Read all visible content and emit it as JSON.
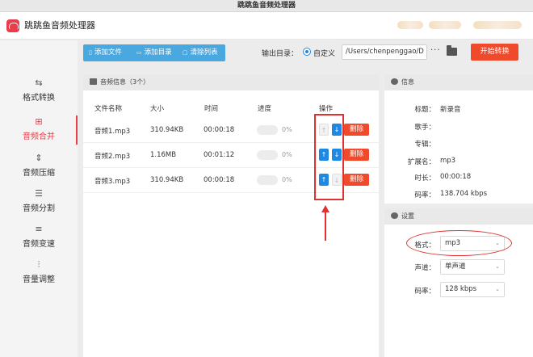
{
  "window": {
    "title": "跳跳鱼音频处理器"
  },
  "app": {
    "name": "跳跳鱼音频处理器"
  },
  "sidebar": {
    "items": [
      {
        "label": "格式转换",
        "icon": "format-convert-icon"
      },
      {
        "label": "音频合并",
        "icon": "merge-icon",
        "active": true
      },
      {
        "label": "音频压缩",
        "icon": "compress-icon"
      },
      {
        "label": "音频分割",
        "icon": "split-icon"
      },
      {
        "label": "音频变速",
        "icon": "speed-icon"
      },
      {
        "label": "音量调整",
        "icon": "volume-icon"
      }
    ]
  },
  "toolbar": {
    "add_file": "添加文件",
    "add_dir": "添加目录",
    "clear_list": "清除列表",
    "output_label": "输出目录：",
    "custom_label": "自定义",
    "output_path": "/Users/chenpenggao/D",
    "more_label": "···",
    "start_label": "开始转换"
  },
  "list_panel": {
    "title": "音频信息（3个）",
    "headers": {
      "name": "文件名称",
      "size": "大小",
      "time": "时间",
      "progress": "进度",
      "action": "操作"
    },
    "rows": [
      {
        "name": "音频1.mp3",
        "size": "310.94KB",
        "time": "00:00:18",
        "progress": "0%",
        "progress_value": 0,
        "delete": "删除"
      },
      {
        "name": "音频2.mp3",
        "size": "1.16MB",
        "time": "00:01:12",
        "progress": "0%",
        "progress_value": 0,
        "delete": "删除"
      },
      {
        "name": "音频3.mp3",
        "size": "310.94KB",
        "time": "00:00:18",
        "progress": "0%",
        "progress_value": 0,
        "delete": "删除"
      }
    ]
  },
  "info_panel": {
    "title": "信息",
    "fields": [
      {
        "key": "标题：",
        "value": "新录音"
      },
      {
        "key": "歌手：",
        "value": ""
      },
      {
        "key": "专辑：",
        "value": ""
      },
      {
        "key": "扩展名：",
        "value": "mp3"
      },
      {
        "key": "时长：",
        "value": "00:00:18"
      },
      {
        "key": "码率：",
        "value": "138.704 kbps"
      }
    ]
  },
  "settings_panel": {
    "title": "设置",
    "fields": [
      {
        "key": "格式：",
        "value": "mp3"
      },
      {
        "key": "声道：",
        "value": "单声道"
      },
      {
        "key": "码率：",
        "value": "128 kbps"
      }
    ]
  },
  "colors": {
    "accent": "#e83e4b",
    "primary": "#1e88e5",
    "toolbar": "#4aa8e0",
    "danger": "#ef4a2c",
    "annotation": "#e03030"
  }
}
